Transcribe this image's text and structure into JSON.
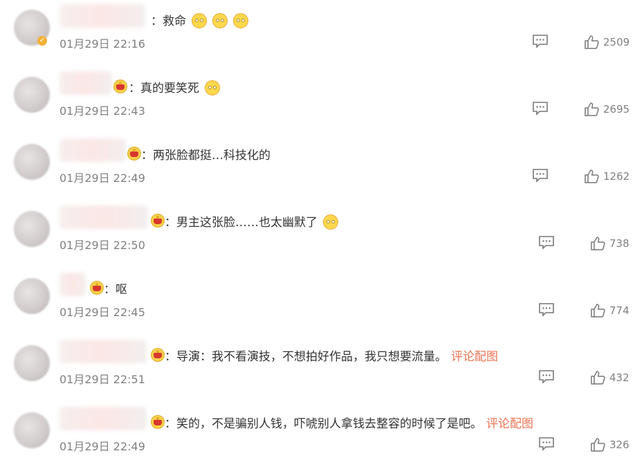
{
  "comments": [
    {
      "text": "：救命",
      "emojis": 3,
      "time": "01月29日 22:16",
      "likes": "2509",
      "link": ""
    },
    {
      "text": "：真的要笑死",
      "emojis": 1,
      "time": "01月29日 22:43",
      "likes": "2695",
      "link": ""
    },
    {
      "text": "：两张脸都挺…科技化的",
      "emojis": 0,
      "time": "01月29日 22:49",
      "likes": "1262",
      "link": ""
    },
    {
      "text": "：男主这张脸……也太幽默了",
      "emojis": 1,
      "time": "01月29日 22:50",
      "likes": "738",
      "link": ""
    },
    {
      "text": "：呕",
      "emojis": 0,
      "time": "01月29日 22:45",
      "likes": "774",
      "link": ""
    },
    {
      "text": "：导演：我不看演技，不想拍好作品，我只想要流量。",
      "emojis": 0,
      "time": "01月29日 22:51",
      "likes": "432",
      "link": "评论配图"
    },
    {
      "text": "：笑的，不是骗别人钱，吓唬别人拿钱去整容的时候了是吧。",
      "emojis": 0,
      "time": "01月29日 22:49",
      "likes": "326",
      "link": "评论配图"
    }
  ],
  "colors": {
    "link": "#eb7350",
    "muted": "#808080",
    "text": "#333333"
  },
  "icons": {
    "reply": "comment-icon",
    "like": "thumbs-up-icon",
    "badge": "crown-badge-icon"
  }
}
